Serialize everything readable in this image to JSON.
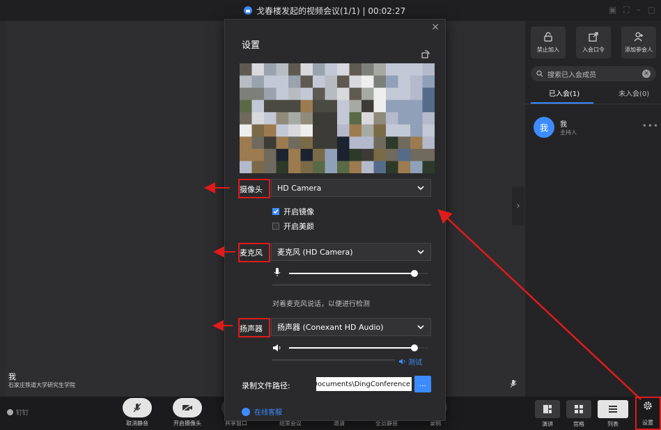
{
  "window": {
    "title": "戈春楼发起的视频会议(1/1) | 00:02:27"
  },
  "video": {
    "name": "我",
    "org": "石家庄铁道大学研究生学院"
  },
  "toolbar": {
    "logo": "钉钉",
    "buttons": [
      {
        "label": "取消静音"
      },
      {
        "label": "开启摄像头"
      },
      {
        "label": "共享窗口"
      },
      {
        "label": "结束会议"
      },
      {
        "label": "邀请"
      },
      {
        "label": "全员静音"
      },
      {
        "label": "录制"
      }
    ],
    "views": [
      {
        "label": "演讲"
      },
      {
        "label": "宫格"
      },
      {
        "label": "列表"
      }
    ],
    "settings_label": "设置"
  },
  "panel": {
    "buttons": [
      {
        "label": "禁止加入"
      },
      {
        "label": "入会口令"
      },
      {
        "label": "添加参会人"
      }
    ],
    "search_placeholder": "搜索已入会成员",
    "tabs": [
      {
        "label": "已入会(1)"
      },
      {
        "label": "未入会(0)"
      }
    ],
    "member": {
      "avatar": "我",
      "name": "我",
      "role": "主持人"
    }
  },
  "dialog": {
    "title": "设置",
    "camera_label": "摄像头",
    "camera_value": "HD Camera",
    "mirror_label": "开启镜像",
    "mirror_checked": true,
    "beauty_label": "开启美颜",
    "beauty_checked": false,
    "mic_label": "麦克风",
    "mic_value": "麦克风 (HD Camera)",
    "mic_volume": 0.9,
    "mic_hint": "对着麦克风说话，以便进行检测",
    "speaker_label": "扬声器",
    "speaker_value": "扬声器 (Conexant HD Audio)",
    "speaker_volume": 0.9,
    "test_label": "测试",
    "path_label": "录制文件路径:",
    "path_value": "ers\\hp\\Documents\\DingConference",
    "path_button": "...",
    "help_label": "在线客服"
  },
  "colors": {
    "accent": "#3d8cff",
    "annotation": "#e01b1b"
  }
}
